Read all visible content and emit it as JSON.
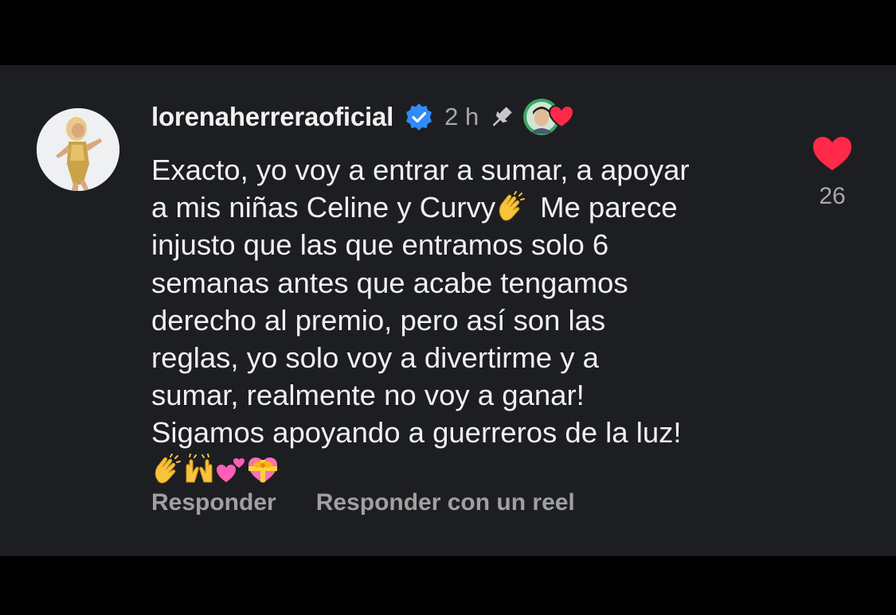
{
  "comment": {
    "username": "lorenaherreraoficial",
    "time": "2 h",
    "text_lines": [
      "Exacto, yo voy a entrar a sumar, a apoyar",
      "a mis niñas Celine y Curvy",
      "Me parece",
      "injusto que las que entramos solo 6",
      "semanas antes que acabe tengamos",
      "derecho al premio, pero así son las",
      "reglas, yo solo voy a divertirme y a",
      "sumar, realmente no voy a ganar!",
      "Sigamos apoyando a guerreros de la luz!"
    ],
    "emojis": [
      "clapping-hands-emoji",
      "raising-hands-emoji",
      "two-hearts-emoji",
      "heart-with-ribbon-emoji"
    ],
    "actions": {
      "reply": "Responder",
      "reply_reel": "Responder con un reel"
    },
    "likes": "26"
  },
  "colors": {
    "background": "#000000",
    "panel": "#1c1e22",
    "text": "#f1f1f1",
    "muted": "#a0a0a0",
    "verified": "#2f8cff",
    "heart": "#ff2a4a"
  },
  "icons": {
    "verified": "verified-badge-icon",
    "pin": "pin-icon",
    "like": "heart-icon"
  }
}
